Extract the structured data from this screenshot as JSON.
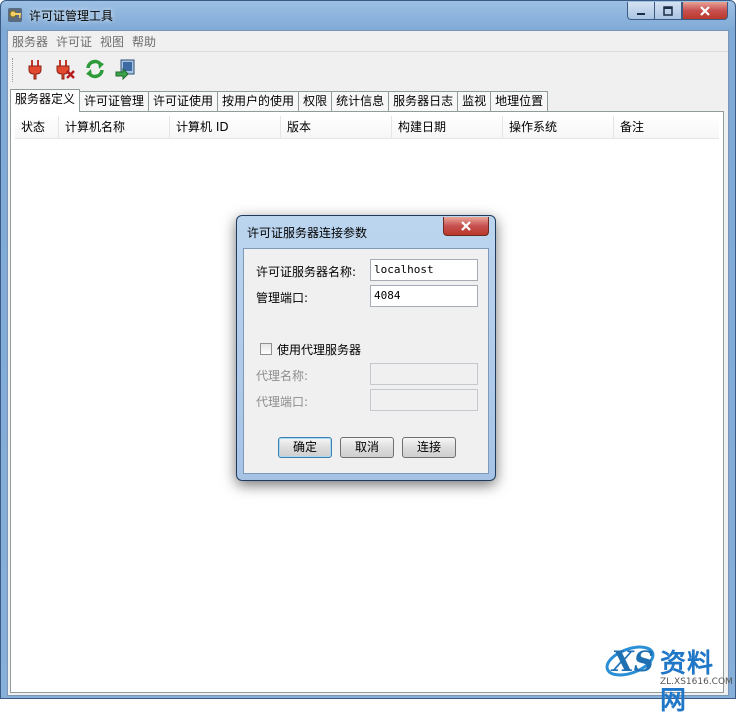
{
  "window": {
    "title": "许可证管理工具",
    "minimize": "0",
    "maximize": "1",
    "close": "r"
  },
  "menu": [
    "服务器",
    "许可证",
    "视图",
    "帮助"
  ],
  "toolbar": [
    {
      "icon": "plug-connect-icon"
    },
    {
      "icon": "plug-disconnect-icon"
    },
    {
      "icon": "refresh-icon"
    },
    {
      "icon": "server-export-icon"
    }
  ],
  "tabs": [
    {
      "label": "服务器定义",
      "active": true
    },
    {
      "label": "许可证管理"
    },
    {
      "label": "许可证使用"
    },
    {
      "label": "按用户的使用"
    },
    {
      "label": "权限"
    },
    {
      "label": "统计信息"
    },
    {
      "label": "服务器日志"
    },
    {
      "label": "监视"
    },
    {
      "label": "地理位置"
    }
  ],
  "table": {
    "columns": [
      "状态",
      "计算机名称",
      "计算机 ID",
      "版本",
      "构建日期",
      "操作系统",
      "备注"
    ]
  },
  "dialog": {
    "title": "许可证服务器连接参数",
    "server_name_label": "许可证服务器名称:",
    "server_name_value": "localhost",
    "port_label": "管理端口:",
    "port_value": "4084",
    "proxy_checkbox_label": "使用代理服务器",
    "proxy_checked": false,
    "proxy_name_label": "代理名称:",
    "proxy_name_value": "",
    "proxy_port_label": "代理端口:",
    "proxy_port_value": "",
    "ok_label": "确定",
    "cancel_label": "取消",
    "connect_label": "连接"
  },
  "watermark": {
    "brand": "资料网",
    "url": "ZL.XS1616.COM",
    "logo": "XS"
  }
}
